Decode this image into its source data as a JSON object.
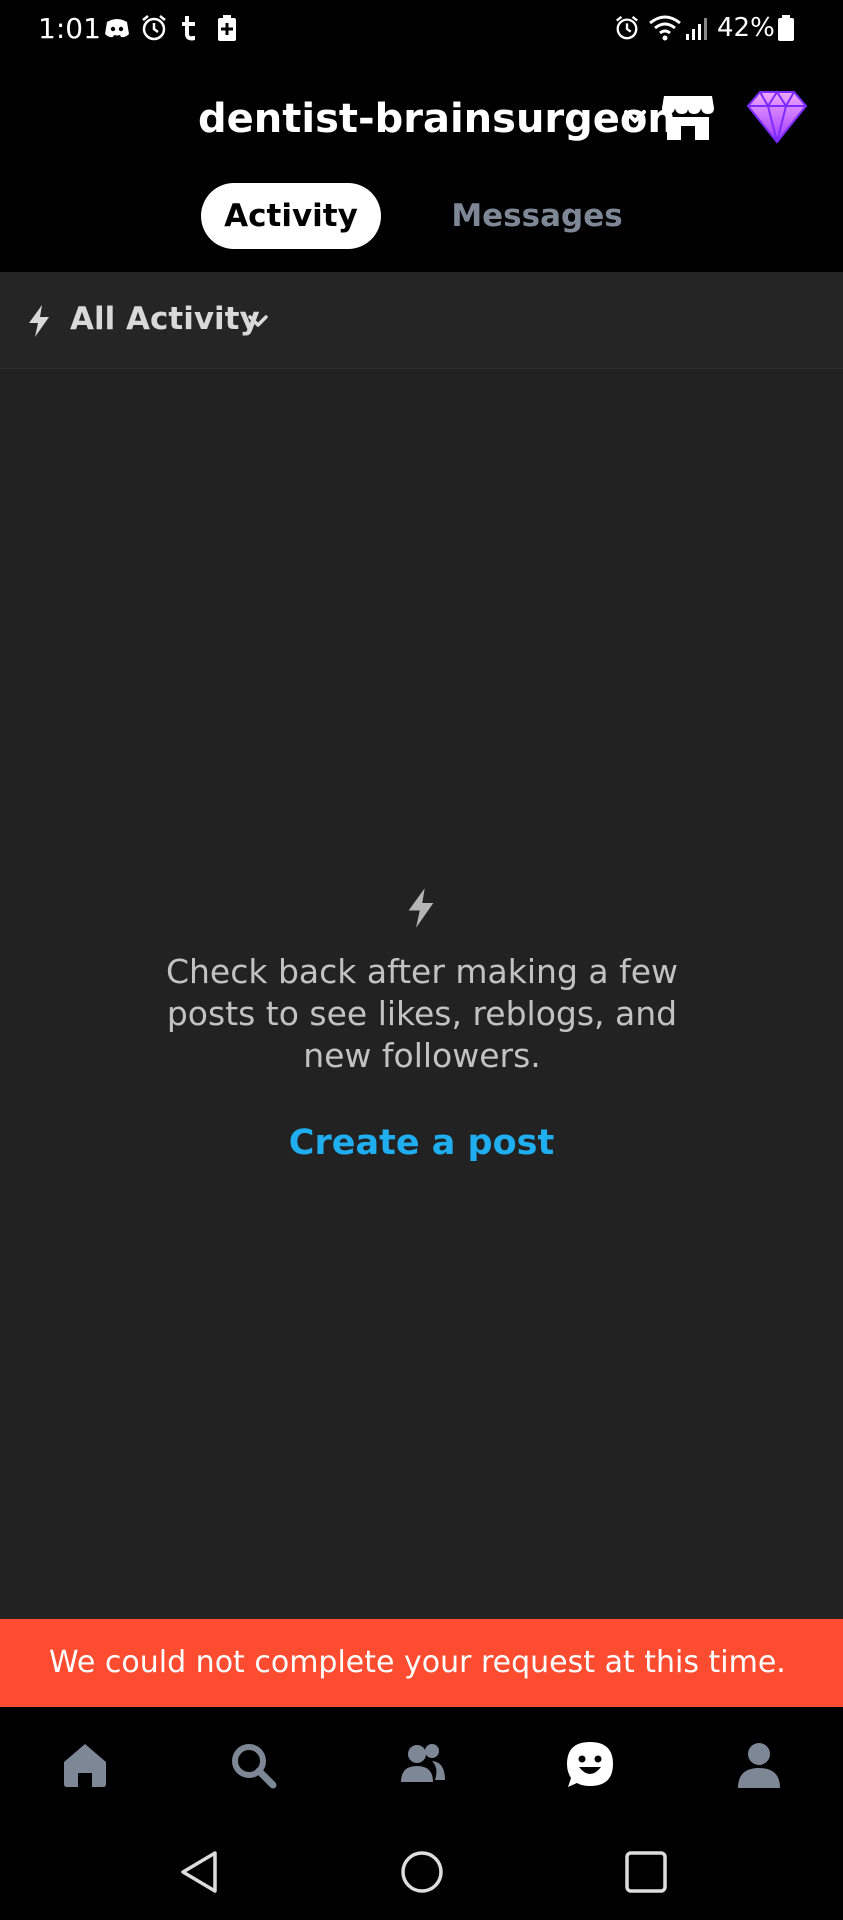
{
  "status_bar": {
    "time": "1:01",
    "battery_percent": "42%",
    "left_icons": [
      "discord-icon",
      "alarm-icon",
      "tumblr-icon",
      "battery-saver-icon"
    ],
    "right_icons": [
      "alarm-icon",
      "wifi-icon",
      "signal-icon",
      "battery-icon"
    ]
  },
  "header": {
    "blog_name": "dentist-brainsurgeon",
    "icons": [
      "chevron-down-icon",
      "shop-icon",
      "gem-icon"
    ],
    "tabs": [
      {
        "label": "Activity",
        "active": true
      },
      {
        "label": "Messages",
        "active": false
      }
    ]
  },
  "filter": {
    "label": "All Activity",
    "icon": "lightning-icon"
  },
  "empty_state": {
    "message": "Check back after making a few posts to see likes, reblogs, and new followers.",
    "action_label": "Create a post"
  },
  "error_banner": {
    "message": "We could not complete your request at this time."
  },
  "bottom_nav": {
    "items": [
      "home-icon",
      "search-icon",
      "communities-icon",
      "activity-icon",
      "account-icon"
    ],
    "active_index": 3
  },
  "colors": {
    "accent_blue": "#1faff0",
    "error_red": "#fe4c31",
    "background": "#222222",
    "inactive_gray": "#7e8796"
  }
}
